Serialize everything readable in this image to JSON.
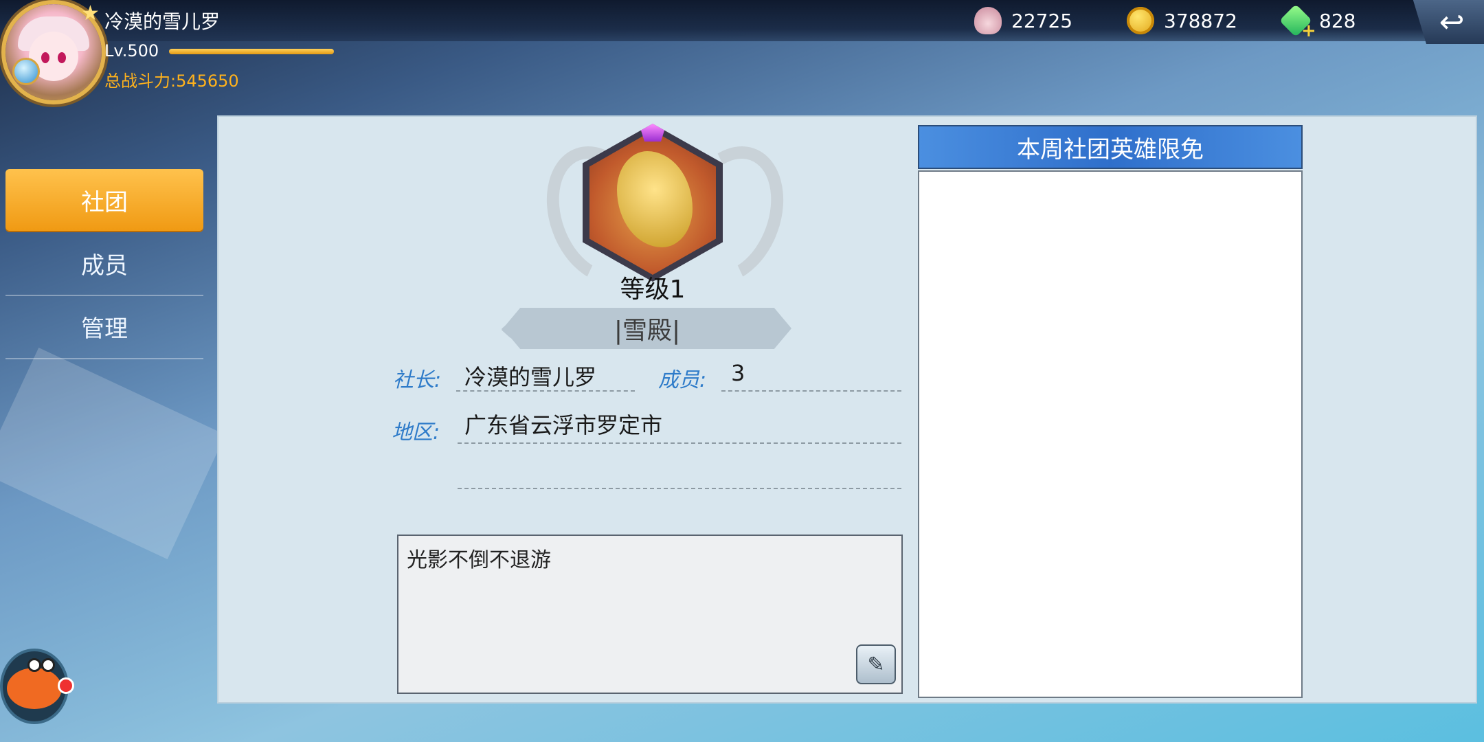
{
  "player": {
    "name": "冷漠的雪儿罗",
    "level": "Lv.500",
    "exp_fraction": 1.0,
    "power": "总战斗力:545650"
  },
  "resources": {
    "shells": "22725",
    "gold": "378872",
    "gems": "828"
  },
  "nav": {
    "items": [
      {
        "label": "社团",
        "active": true
      },
      {
        "label": "成员",
        "active": false
      },
      {
        "label": "管理",
        "active": false
      }
    ]
  },
  "guild": {
    "level": "等级1",
    "name": "|雪殿|",
    "leader_label": "社长:",
    "leader": "冷漠的雪儿罗",
    "members_label": "成员:",
    "members": "3",
    "region_label": "地区:",
    "region": "广东省云浮市罗定市",
    "motto": "光影不倒不退游"
  },
  "hero_panel": {
    "title": "本周社团英雄限免"
  },
  "colors": {
    "accent_orange": "#f09a13",
    "label_blue": "#2e7bc9",
    "header_blue": "#2f6fcb"
  }
}
